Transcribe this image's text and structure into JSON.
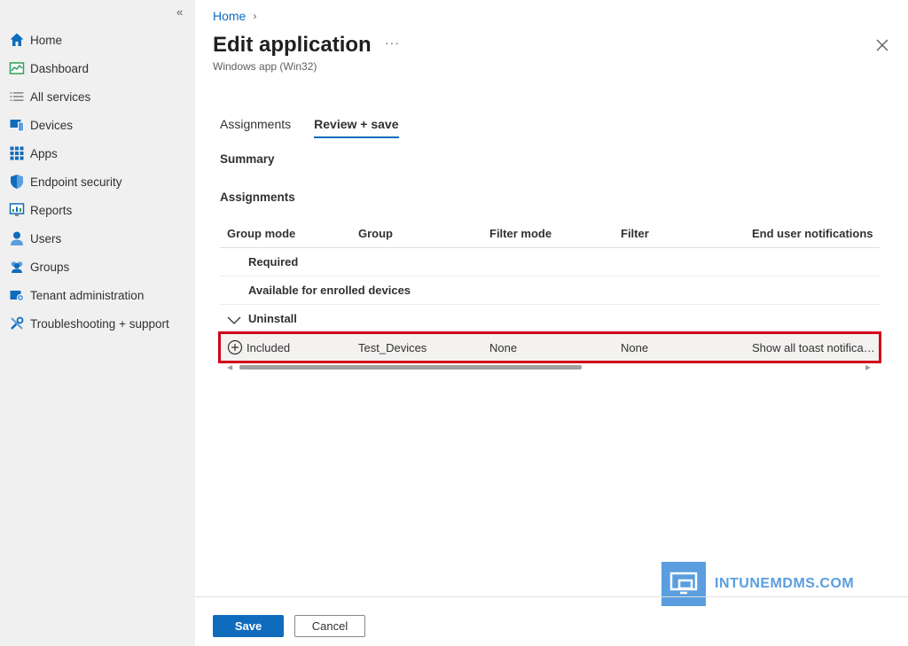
{
  "sidebar": {
    "items": [
      {
        "label": "Home",
        "icon": "home-icon"
      },
      {
        "label": "Dashboard",
        "icon": "dashboard-icon"
      },
      {
        "label": "All services",
        "icon": "list-icon"
      },
      {
        "label": "Devices",
        "icon": "devices-icon"
      },
      {
        "label": "Apps",
        "icon": "apps-grid-icon"
      },
      {
        "label": "Endpoint security",
        "icon": "shield-icon"
      },
      {
        "label": "Reports",
        "icon": "reports-icon"
      },
      {
        "label": "Users",
        "icon": "user-icon"
      },
      {
        "label": "Groups",
        "icon": "groups-icon"
      },
      {
        "label": "Tenant administration",
        "icon": "tenant-admin-icon"
      },
      {
        "label": "Troubleshooting + support",
        "icon": "tools-icon"
      }
    ]
  },
  "header": {
    "breadcrumb": "Home",
    "title": "Edit application",
    "more": "···",
    "subtitle": "Windows app (Win32)"
  },
  "tabs": [
    {
      "label": "Assignments",
      "active": false
    },
    {
      "label": "Review + save",
      "active": true
    }
  ],
  "sections": {
    "summary": "Summary",
    "assignments": "Assignments"
  },
  "table": {
    "columns": [
      "Group mode",
      "Group",
      "Filter mode",
      "Filter",
      "End user notifications"
    ],
    "groups": [
      {
        "label": "Required"
      },
      {
        "label": "Available for enrolled devices"
      },
      {
        "label": "Uninstall"
      }
    ],
    "row": {
      "group_mode": "Included",
      "group": "Test_Devices",
      "filter_mode": "None",
      "filter": "None",
      "notifications": "Show all toast notificat..."
    }
  },
  "footer": {
    "save": "Save",
    "cancel": "Cancel"
  },
  "watermark": "INTUNEMDMS.COM",
  "colors": {
    "accent": "#0f6cbd",
    "highlight": "#d0021b",
    "sidebar_bg": "#f0f0f0"
  }
}
